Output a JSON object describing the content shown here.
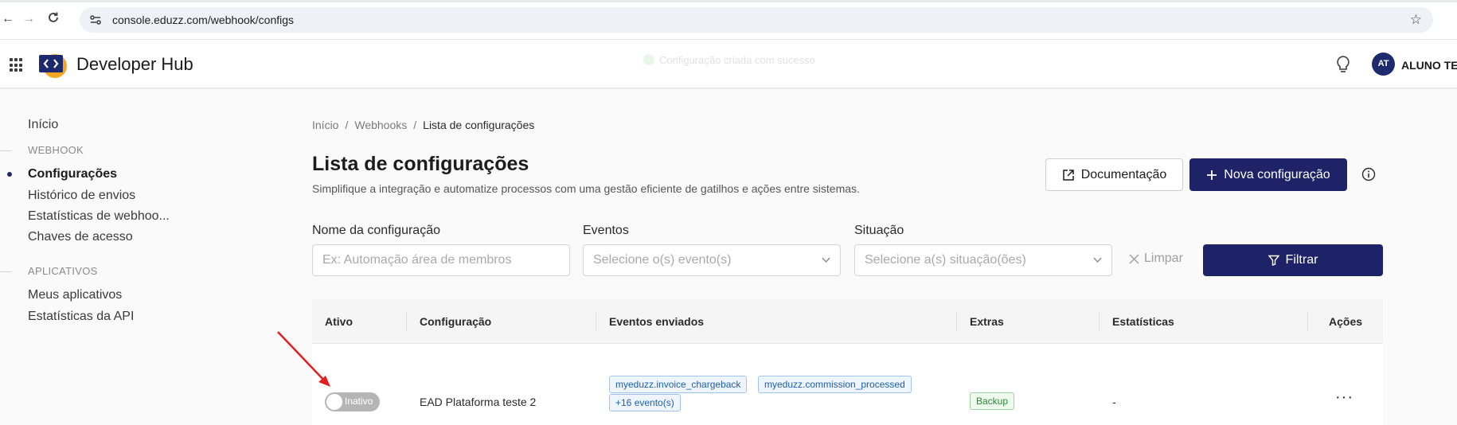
{
  "browser": {
    "url": "console.eduzz.com/webhook/configs"
  },
  "header": {
    "brand": "Developer Hub",
    "toast": "Configuração criada com sucesso",
    "avatar_initials": "AT",
    "username": "ALUNO TES"
  },
  "sidebar": {
    "home": "Início",
    "section_webhook": "WEBHOOK",
    "items_webhook": [
      {
        "label": "Configurações",
        "active": true
      },
      {
        "label": "Histórico de envios",
        "active": false
      },
      {
        "label": "Estatísticas de webhoo...",
        "active": false
      },
      {
        "label": "Chaves de acesso",
        "active": false
      }
    ],
    "section_apps": "APLICATIVOS",
    "items_apps": [
      {
        "label": "Meus aplicativos"
      },
      {
        "label": "Estatísticas da API"
      }
    ]
  },
  "breadcrumb": {
    "home": "Início",
    "sep": "/",
    "webhooks": "Webhooks",
    "current": "Lista de configurações"
  },
  "page": {
    "title": "Lista de configurações",
    "subtitle": "Simplifique a integração e automatize processos com uma gestão eficiente de gatilhos e ações entre sistemas.",
    "doc_button": "Documentação",
    "new_button": "Nova configuração"
  },
  "filters": {
    "name_label": "Nome da configuração",
    "name_placeholder": "Ex: Automação área de membros",
    "events_label": "Eventos",
    "events_placeholder": "Selecione o(s) evento(s)",
    "status_label": "Situação",
    "status_placeholder": "Selecione a(s) situação(ões)",
    "clear_button": "Limpar",
    "filter_button": "Filtrar"
  },
  "table": {
    "columns": [
      "Ativo",
      "Configuração",
      "Eventos enviados",
      "Extras",
      "Estatísticas",
      "Ações"
    ],
    "rows": [
      {
        "status": "Inativo",
        "name": "EAD Plataforma teste 2",
        "events": [
          "myeduzz.invoice_chargeback",
          "myeduzz.commission_processed"
        ],
        "more_events": "+16 evento(s)",
        "extras": "Backup",
        "stats": "-",
        "actions": "···"
      }
    ]
  },
  "colors": {
    "primary": "#1e2266",
    "annotation_arrow": "#e02020"
  }
}
